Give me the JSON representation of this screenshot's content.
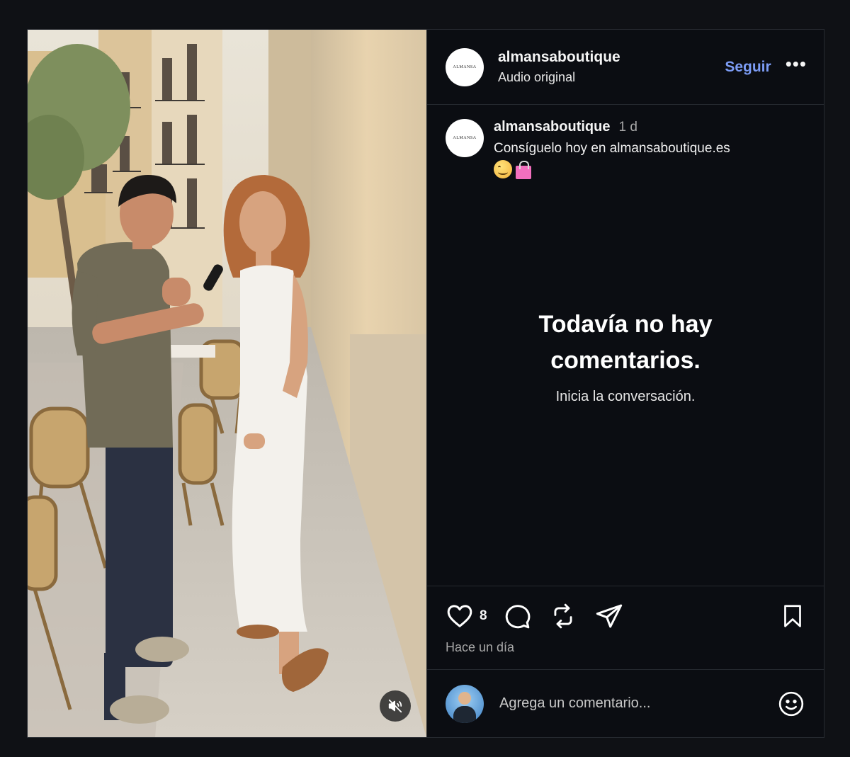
{
  "media": {
    "mute_icon": "speaker-muted-icon"
  },
  "header": {
    "username": "almansaboutique",
    "subtitle": "Audio original",
    "follow_label": "Seguir",
    "more_label": "•••",
    "logo_text": "ALMANSA"
  },
  "caption": {
    "username": "almansaboutique",
    "time": "1 d",
    "text": "Consíguelo hoy en almansaboutique.es",
    "emojis": [
      "smile-emoji",
      "shopping-bag-emoji"
    ]
  },
  "comments": {
    "empty_title": "Todavía no hay comentarios.",
    "empty_subtitle": "Inicia la conversación."
  },
  "actions": {
    "like_count": "8",
    "timestamp": "Hace un día",
    "icons": [
      "heart-icon",
      "comment-icon",
      "repost-icon",
      "share-icon",
      "bookmark-icon"
    ]
  },
  "comment_box": {
    "placeholder": "Agrega un comentario...",
    "emoji_icon": "smiley-icon"
  }
}
